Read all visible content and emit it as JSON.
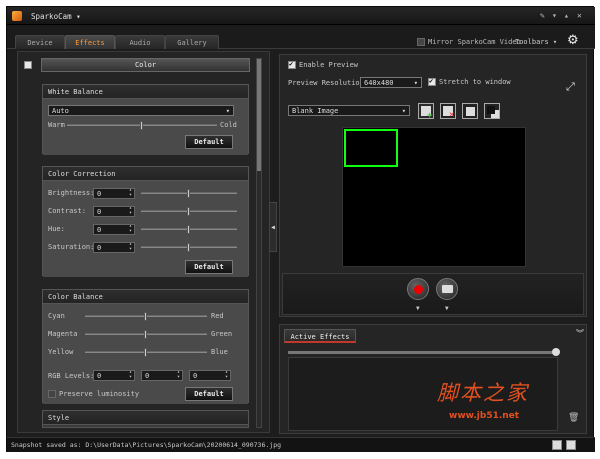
{
  "app": {
    "title": "SparkoCam",
    "title_caret": "▾"
  },
  "titlebar": {
    "pin": "✎",
    "menu": "▾",
    "minimize": "▴",
    "close": "✕"
  },
  "tabs": [
    "Device",
    "Effects",
    "Audio",
    "Gallery"
  ],
  "active_tab": "Effects",
  "header": {
    "mirror_label": "Mirror SparkoCam Video",
    "toolbars_label": "Toolbars ▾"
  },
  "left": {
    "color_header": "Color",
    "white_balance": {
      "title": "White Balance",
      "mode": "Auto",
      "warm": "Warm",
      "cold": "Cold",
      "default": "Default",
      "slider_pos": 0.5
    },
    "color_correction": {
      "title": "Color Correction",
      "default": "Default",
      "rows": [
        {
          "label": "Brightness:",
          "value": "0",
          "pos": 0.5
        },
        {
          "label": "Contrast:",
          "value": "0",
          "pos": 0.5
        },
        {
          "label": "Hue:",
          "value": "0",
          "pos": 0.5
        },
        {
          "label": "Saturation:",
          "value": "0",
          "pos": 0.5
        }
      ]
    },
    "color_balance": {
      "title": "Color Balance",
      "default": "Default",
      "rows": [
        {
          "left": "Cyan",
          "right": "Red",
          "pos": 0.5
        },
        {
          "left": "Magenta",
          "right": "Green",
          "pos": 0.5
        },
        {
          "left": "Yellow",
          "right": "Blue",
          "pos": 0.5
        }
      ],
      "rgb_label": "RGB Levels:",
      "rgb": [
        "0",
        "0",
        "0"
      ],
      "preserve_label": "Preserve luminosity"
    },
    "style_title": "Style"
  },
  "preview": {
    "enable_label": "Enable Preview",
    "resolution_label": "Preview Resolution:",
    "resolution_value": "640x480",
    "stretch_label": "Stretch to window",
    "overlay_value": "Blank Image"
  },
  "effects": {
    "tab_label": "Active Effects"
  },
  "status": {
    "text": "Snapshot saved as: D:\\UserData\\Pictures\\SparkoCam\\20200614_090736.jpg"
  },
  "watermark": {
    "cn": "脚本之家",
    "url": "www.jb51.net"
  },
  "colors": {
    "accent": "#ff9a3a",
    "record": "#ee0000",
    "green_frame": "#11ff11"
  }
}
